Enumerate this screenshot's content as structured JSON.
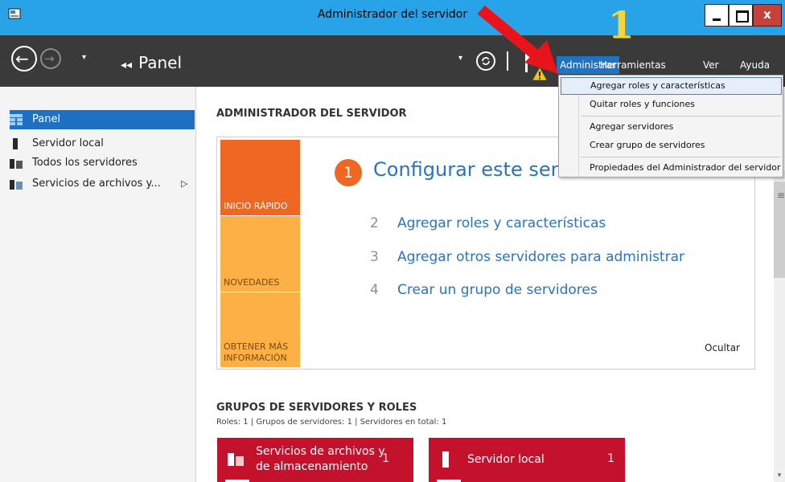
{
  "window": {
    "title": "Administrador del servidor",
    "close_glyph": "x"
  },
  "nav": {
    "back_arrow": "←",
    "forward_arrow": "→",
    "dropdown_glyph": "▾",
    "crumb_glyph": "◂◂",
    "crumb": "Panel",
    "menu": [
      "Administrar",
      "Herramientas",
      "Ver",
      "Ayuda"
    ]
  },
  "sidebar": {
    "items": [
      {
        "label": "Panel",
        "active": true
      },
      {
        "label": "Servidor local"
      },
      {
        "label": "Todos los servidores"
      },
      {
        "label": "Servicios de archivos y...",
        "chevron": "▷"
      }
    ]
  },
  "main": {
    "section1_title": "ADMINISTRADOR DEL SERVIDOR",
    "tiles": [
      "INICIO RÁPIDO",
      "NOVEDADES",
      "OBTENER MÁS INFORMACIÓN"
    ],
    "step1_num": "1",
    "step1_text": "Configurar este servidor local",
    "steps": [
      {
        "num": "2",
        "text": "Agregar roles y características"
      },
      {
        "num": "3",
        "text": "Agregar otros servidores para administrar"
      },
      {
        "num": "4",
        "text": "Crear un grupo de servidores"
      }
    ],
    "hide": "Ocultar",
    "section2_title": "GRUPOS DE SERVIDORES Y ROLES",
    "section2_sub": "Roles: 1   |   Grupos de servidores: 1   |   Servidores en total: 1",
    "cards": [
      {
        "name_line1": "Servicios de archivos y",
        "name_line2": "de almacenamiento",
        "count": "1"
      },
      {
        "name": "Servidor local",
        "count": "1"
      }
    ]
  },
  "dropdown": {
    "items": [
      "Agregar roles y características",
      "Quitar roles y funciones",
      "Agregar servidores",
      "Crear grupo de servidores",
      "Propiedades del Administrador del servidor"
    ]
  },
  "annotation": {
    "number": "1"
  },
  "scroll": {
    "down_glyph": "▾",
    "grip_glyph": "≡"
  },
  "colors": {
    "titlebar": "#29a3e8",
    "navbar": "#3a3a3a",
    "accent": "#1f6fc2",
    "orange": "#ee6823",
    "amber": "#fdb045",
    "card_red": "#c4122c"
  }
}
